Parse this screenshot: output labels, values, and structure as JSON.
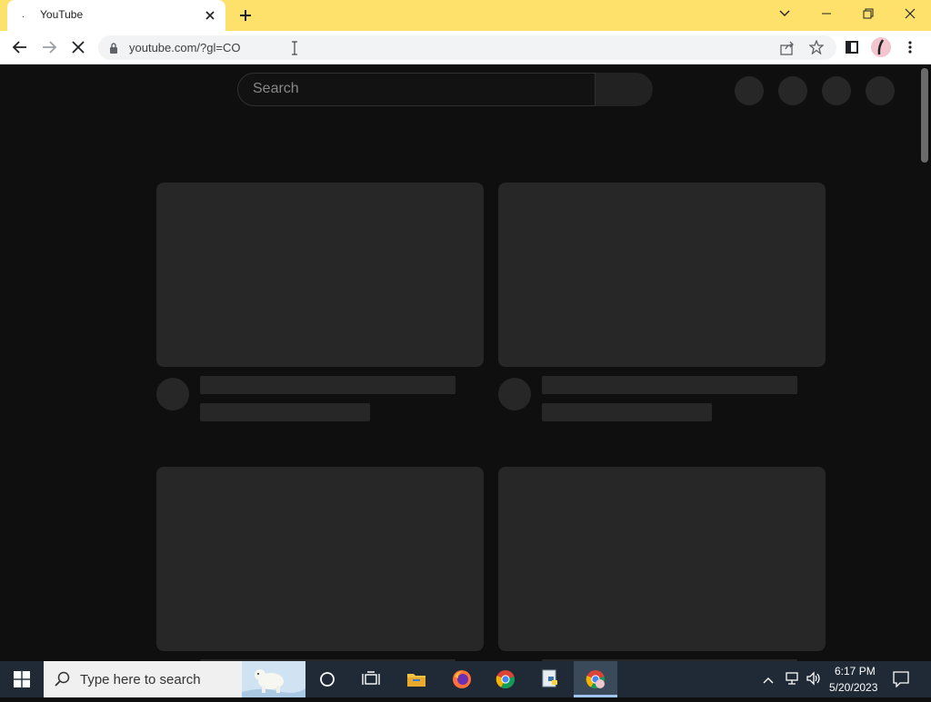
{
  "browser": {
    "tab": {
      "title": "YouTube",
      "favicon": "."
    },
    "url": "youtube.com/?gl=CO",
    "accent_color": "#fde16a"
  },
  "page": {
    "search_placeholder": "Search",
    "background": "#0f0f0f",
    "placeholder_color": "#272727"
  },
  "taskbar": {
    "search_placeholder": "Type here to search",
    "time": "6:17 PM",
    "date": "5/20/2023"
  }
}
